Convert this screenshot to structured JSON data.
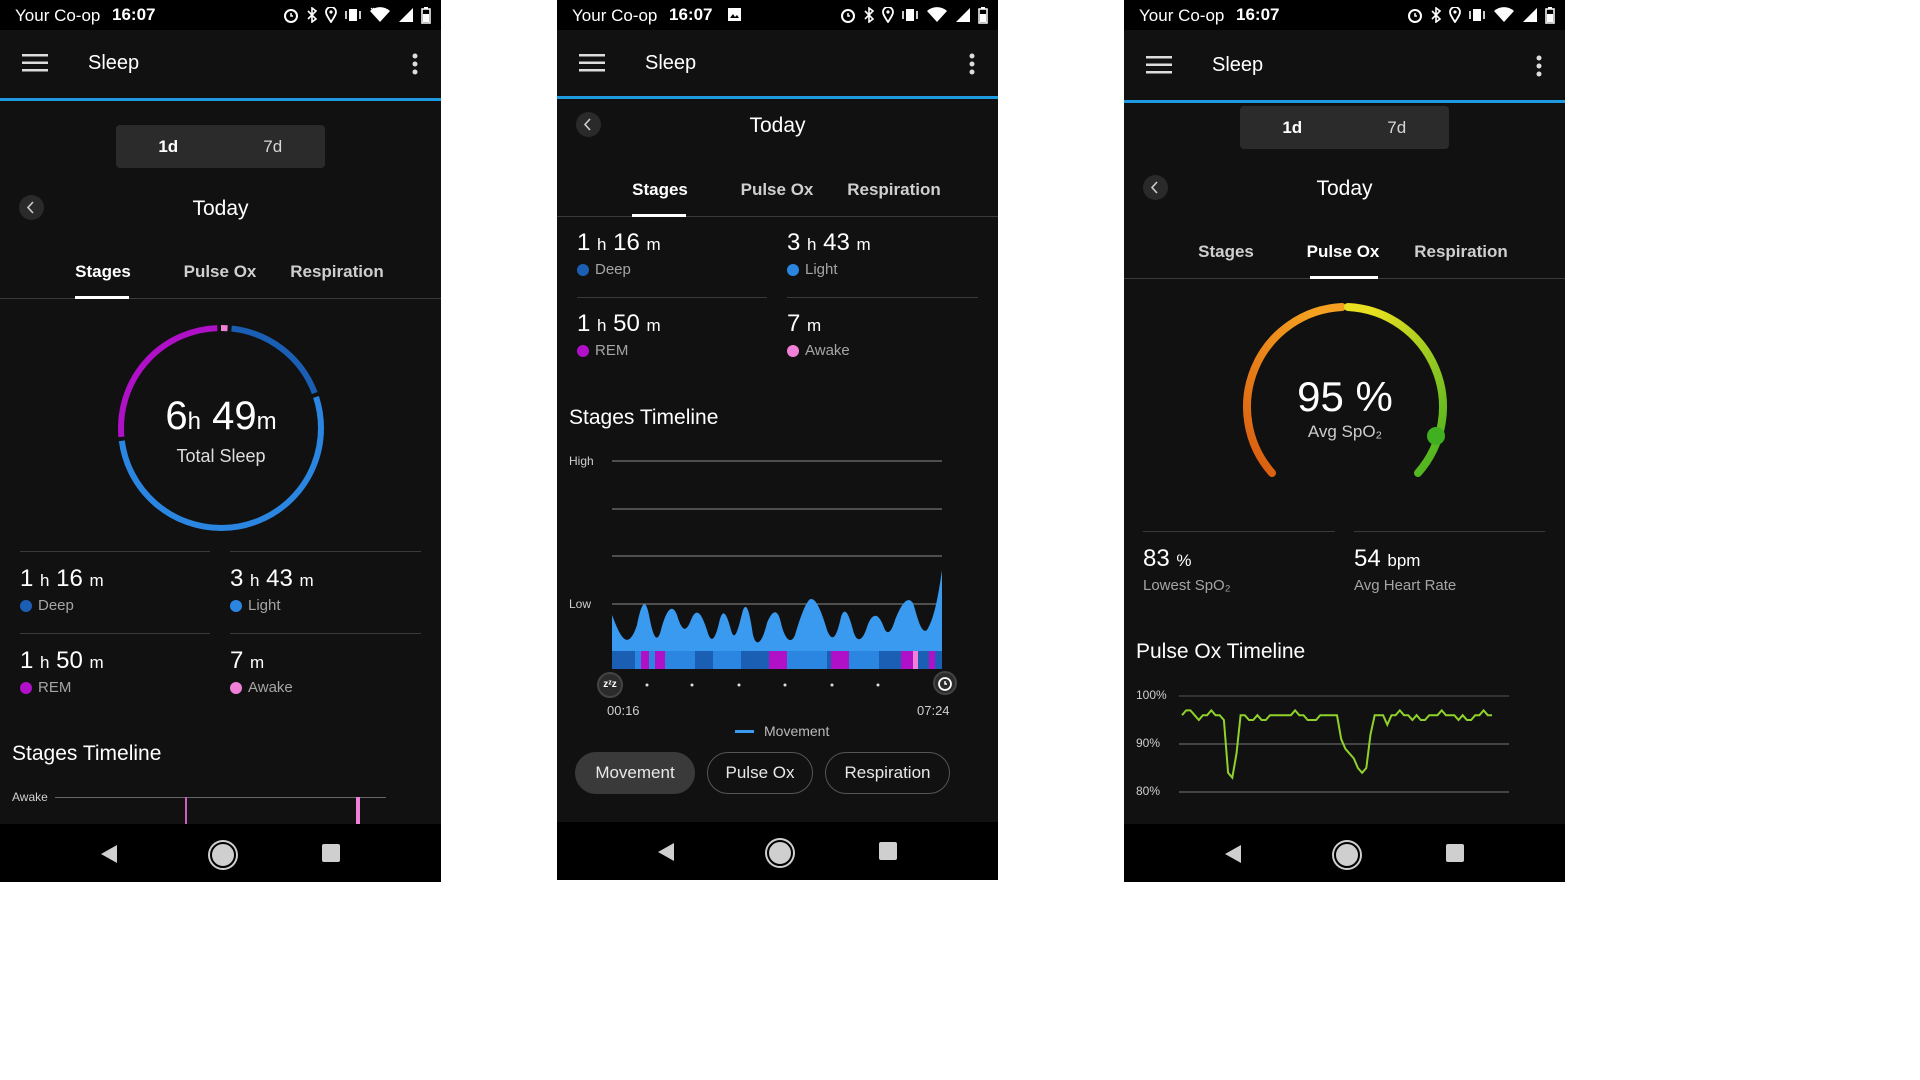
{
  "status": {
    "carrier": "Your Co-op",
    "time": "16:07"
  },
  "app": {
    "title": "Sleep"
  },
  "range": {
    "d1": "1d",
    "d7": "7d"
  },
  "day": "Today",
  "tabs": {
    "stages": "Stages",
    "pulse_ox": "Pulse Ox",
    "respiration": "Respiration"
  },
  "total_sleep": {
    "hours": "6",
    "minutes": "49",
    "h_unit": "h",
    "m_unit": "m",
    "label": "Total Sleep"
  },
  "stages": {
    "deep": {
      "hours": "1",
      "minutes": "16",
      "label": "Deep",
      "color": "#1a5fb4"
    },
    "light": {
      "hours": "3",
      "minutes": "43",
      "label": "Light",
      "color": "#2a86e0"
    },
    "rem": {
      "hours": "1",
      "minutes": "50",
      "label": "REM",
      "color": "#b010c8"
    },
    "awake": {
      "minutes": "7",
      "label": "Awake",
      "color": "#f080d8"
    }
  },
  "units": {
    "h": "h",
    "m": "m"
  },
  "stages_timeline": {
    "title": "Stages Timeline",
    "awake_label": "Awake",
    "high_label": "High",
    "low_label": "Low",
    "start": "00:16",
    "end": "07:24",
    "legend": "Movement"
  },
  "chips": {
    "movement": "Movement",
    "pulse_ox": "Pulse Ox",
    "respiration": "Respiration"
  },
  "pulse_ox": {
    "avg_value": "95",
    "avg_unit": "%",
    "avg_label": "Avg SpO₂",
    "lowest_value": "83",
    "lowest_unit": "%",
    "lowest_label": "Lowest SpO₂",
    "hr_value": "54",
    "hr_unit": "bpm",
    "hr_label": "Avg Heart Rate",
    "timeline_title": "Pulse Ox Timeline",
    "axis": [
      "100%",
      "90%",
      "80%"
    ]
  },
  "colors": {
    "accent": "#1e9ae0",
    "movement": "#3a9af0",
    "spo2_line": "#8fd22a"
  },
  "icons": [
    "menu-icon",
    "more-icon",
    "back-chevron-icon",
    "alarm-icon",
    "bluetooth-icon",
    "location-icon",
    "vibrate-icon",
    "wifi-icon",
    "signal-icon",
    "battery-icon",
    "image-icon",
    "sleep-zzz-icon",
    "alarm-clock-icon",
    "nav-back-icon",
    "nav-home-icon",
    "nav-recents-icon"
  ],
  "chart_data": [
    {
      "type": "pie",
      "title": "Total Sleep",
      "categories": [
        "Deep",
        "Light",
        "REM",
        "Awake"
      ],
      "values": [
        76,
        223,
        110,
        7
      ],
      "units": "minutes"
    },
    {
      "type": "area",
      "title": "Stages Timeline",
      "series": [
        {
          "name": "Movement"
        }
      ],
      "x_range": [
        "00:16",
        "07:24"
      ],
      "ylabels": [
        "High",
        "Low"
      ]
    },
    {
      "type": "line",
      "title": "Pulse Ox Timeline",
      "ylim": [
        80,
        100
      ],
      "ytick_labels": [
        "100%",
        "90%",
        "80%"
      ],
      "series": [
        {
          "values": [
            96,
            97,
            97,
            96,
            95,
            96,
            96,
            97,
            96,
            96,
            95,
            84,
            83,
            88,
            96,
            96,
            95,
            95,
            96,
            95,
            95,
            96,
            96,
            96,
            96,
            96,
            96,
            97,
            96,
            96,
            95,
            95,
            95,
            96,
            96,
            96,
            96,
            96,
            91,
            89,
            88,
            87,
            85,
            84,
            85,
            92,
            96,
            96,
            96,
            94,
            96,
            96,
            97,
            96,
            96,
            95,
            96,
            95,
            95,
            96,
            96,
            96,
            97,
            96,
            96,
            96,
            95,
            96,
            95,
            95,
            96,
            96,
            97,
            96,
            96
          ]
        }
      ]
    }
  ]
}
